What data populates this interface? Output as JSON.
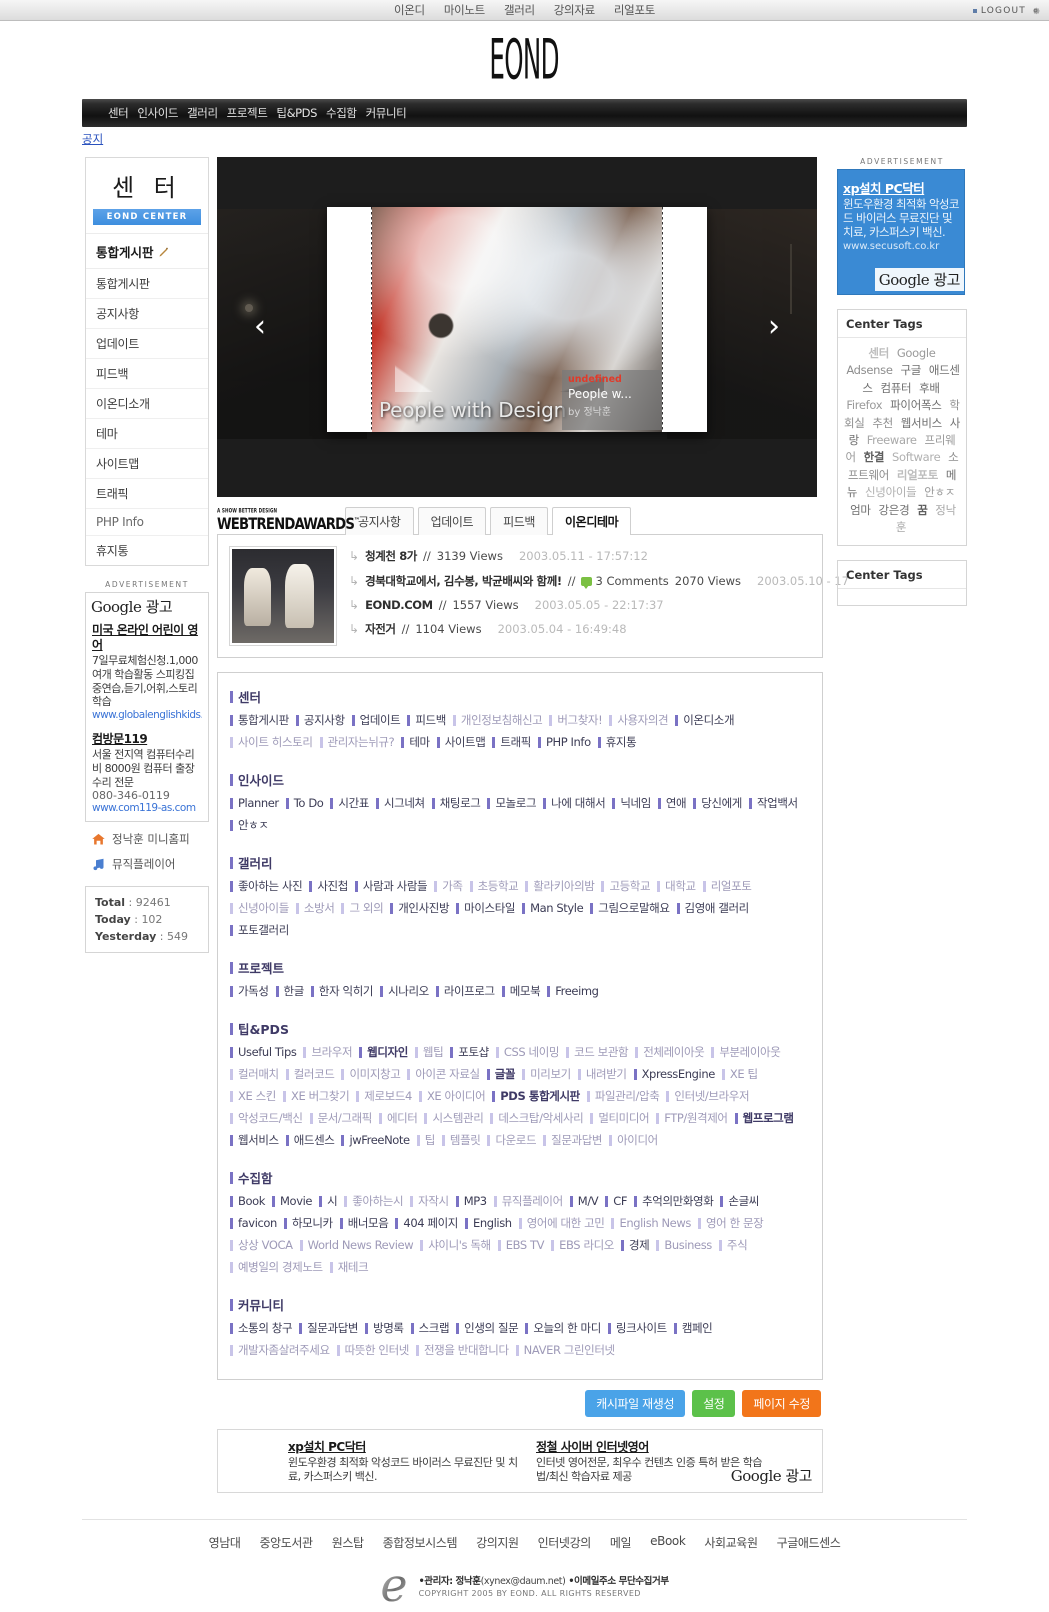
{
  "topbar": {
    "nav": [
      "이온디",
      "마이노트",
      "갤러리",
      "강의자료",
      "리얼포토"
    ],
    "logout_label": "LOGOUT"
  },
  "logo": {
    "text": "EOND"
  },
  "blacknav": {
    "items": [
      "센터",
      "인사이드",
      "갤러리",
      "프로젝트",
      "팁&PDS",
      "수집함",
      "커뮤니티"
    ]
  },
  "subnav": {
    "label": "공지"
  },
  "sidebar": {
    "title": "센 터",
    "badge": "EOND CENTER",
    "head": "통합게시판",
    "items": [
      {
        "label": "통합게시판"
      },
      {
        "label": "공지사항"
      },
      {
        "label": "업데이트"
      },
      {
        "label": "피드백"
      },
      {
        "label": "이온디소개"
      },
      {
        "label": "테마"
      },
      {
        "label": "사이트맵"
      },
      {
        "label": "트래픽"
      },
      {
        "label": "PHP Info"
      },
      {
        "label": "휴지통"
      }
    ],
    "advertisement_label": "ADVERTISEMENT",
    "google_ad_label": "Google 광고",
    "ads": [
      {
        "title": "미국 온라인 어린이 영어",
        "desc": "7일무료체험신청.1,000여개 학습활동 스피킹집중연습,듣기,어휘,스토리학습",
        "url": "www.globalenglishkids.c"
      },
      {
        "title": "컴방문119",
        "desc": "서울 전지역 컴퓨터수리비 8000원 컴퓨터 출장수리 전문",
        "phone": "080-346-0119",
        "url": "www.com119-as.com"
      }
    ],
    "quick_links": [
      {
        "label": "정낙훈 미니홈피",
        "icon": "home-icon"
      },
      {
        "label": "뮤직플레이어",
        "icon": "music-note-icon"
      }
    ],
    "stats": [
      {
        "label": "Total",
        "value": "92461"
      },
      {
        "label": "Today",
        "value": "102"
      },
      {
        "label": "Yesterday",
        "value": "549"
      }
    ]
  },
  "slideshow": {
    "caption": "People with Design",
    "info_tag": "undefined",
    "info_title": "People w...",
    "info_by": "by 정낙훈",
    "prev": "‹",
    "next": "›"
  },
  "awards_badge": {
    "line1": "A  SHOW BETTER DESIGN",
    "line2": "WEBTRENDAWARDS",
    "tm": "™"
  },
  "tabs": [
    {
      "label": "공지사항",
      "active": false
    },
    {
      "label": "업데이트",
      "active": false
    },
    {
      "label": "피드백",
      "active": false
    },
    {
      "label": "이온디테마",
      "active": true
    }
  ],
  "posts": [
    {
      "title": "청계천 8가",
      "sep": "//",
      "views": "3139 Views",
      "date": "2003.05.11 - 17:57:12",
      "comments": ""
    },
    {
      "title": "경북대학교에서, 김수봉, 박균배씨와 함께!",
      "sep": "//",
      "comments": "3 Comments",
      "views": "2070 Views",
      "date": "2003.05.10 - 17"
    },
    {
      "title": "EOND.COM",
      "sep": "//",
      "views": "1557 Views",
      "date": "2003.05.05 - 22:17:37",
      "comments": ""
    },
    {
      "title": "자전거",
      "sep": "//",
      "views": "1104 Views",
      "date": "2003.05.04 - 16:49:48",
      "comments": ""
    }
  ],
  "sitemap": [
    {
      "heading": "센터",
      "links": [
        {
          "label": "통합게시판",
          "state": "on"
        },
        {
          "label": "공지사항",
          "state": "on"
        },
        {
          "label": "업데이트",
          "state": "on"
        },
        {
          "label": "피드백",
          "state": "on"
        },
        {
          "label": "개인정보침해신고",
          "state": "dim"
        },
        {
          "label": "버그찾자!",
          "state": "dim"
        },
        {
          "label": "사용자의견",
          "state": "dim"
        },
        {
          "label": "이온디소개",
          "state": "on"
        },
        {
          "label": "사이트 히스토리",
          "state": "dim"
        },
        {
          "label": "관리자는뉘규?",
          "state": "dim"
        },
        {
          "label": "테마",
          "state": "on"
        },
        {
          "label": "사이트맵",
          "state": "on"
        },
        {
          "label": "트래픽",
          "state": "on"
        },
        {
          "label": "PHP Info",
          "state": "on"
        },
        {
          "label": "휴지통",
          "state": "on"
        }
      ]
    },
    {
      "heading": "인사이드",
      "links": [
        {
          "label": "Planner",
          "state": "on"
        },
        {
          "label": "To Do",
          "state": "on"
        },
        {
          "label": "시간표",
          "state": "on"
        },
        {
          "label": "시그네쳐",
          "state": "on"
        },
        {
          "label": "채팅로그",
          "state": "on"
        },
        {
          "label": "모놀로그",
          "state": "on"
        },
        {
          "label": "나에 대해서",
          "state": "on"
        },
        {
          "label": "닉네임",
          "state": "on"
        },
        {
          "label": "연애",
          "state": "on"
        },
        {
          "label": "당신에게",
          "state": "on"
        },
        {
          "label": "작업백서",
          "state": "on"
        },
        {
          "label": "안ㅎㅈ",
          "state": "on"
        }
      ]
    },
    {
      "heading": "갤러리",
      "links": [
        {
          "label": "좋아하는 사진",
          "state": "on"
        },
        {
          "label": "사진첩",
          "state": "on"
        },
        {
          "label": "사람과 사람들",
          "state": "on"
        },
        {
          "label": "가족",
          "state": "dim"
        },
        {
          "label": "초등학교",
          "state": "dim"
        },
        {
          "label": "활라키아의밤",
          "state": "dim"
        },
        {
          "label": "고등학교",
          "state": "dim"
        },
        {
          "label": "대학교",
          "state": "dim"
        },
        {
          "label": "리얼포토",
          "state": "dim"
        },
        {
          "label": "신녕아이들",
          "state": "dim"
        },
        {
          "label": "소방서",
          "state": "dim"
        },
        {
          "label": "그 외의",
          "state": "dim"
        },
        {
          "label": "개인사진방",
          "state": "on"
        },
        {
          "label": "마이스타일",
          "state": "on"
        },
        {
          "label": "Man Style",
          "state": "on"
        },
        {
          "label": "그림으로말해요",
          "state": "on"
        },
        {
          "label": "김영애 갤러리",
          "state": "on"
        },
        {
          "label": "포토갤러리",
          "state": "on"
        }
      ]
    },
    {
      "heading": "프로젝트",
      "links": [
        {
          "label": "가독성",
          "state": "on"
        },
        {
          "label": "한글",
          "state": "on"
        },
        {
          "label": "한자 익히기",
          "state": "on"
        },
        {
          "label": "시나리오",
          "state": "on"
        },
        {
          "label": "라이프로그",
          "state": "on"
        },
        {
          "label": "메모북",
          "state": "on"
        },
        {
          "label": "Freeimg",
          "state": "on"
        }
      ]
    },
    {
      "heading": "팁&PDS",
      "links": [
        {
          "label": "Useful Tips",
          "state": "on"
        },
        {
          "label": "브라우저",
          "state": "dim"
        },
        {
          "label": "웹디자인",
          "state": "bold"
        },
        {
          "label": "웹팁",
          "state": "dim"
        },
        {
          "label": "포토샵",
          "state": "on"
        },
        {
          "label": "CSS 네이밍",
          "state": "dim"
        },
        {
          "label": "코드 보관함",
          "state": "dim"
        },
        {
          "label": "전체레이아웃",
          "state": "dim"
        },
        {
          "label": "부분레이아웃",
          "state": "dim"
        },
        {
          "label": "컬러매치",
          "state": "dim"
        },
        {
          "label": "컬러코드",
          "state": "dim"
        },
        {
          "label": "이미지창고",
          "state": "dim"
        },
        {
          "label": "아이콘 자료실",
          "state": "dim"
        },
        {
          "label": "글꼴",
          "state": "bold"
        },
        {
          "label": "미리보기",
          "state": "dim"
        },
        {
          "label": "내려받기",
          "state": "dim"
        },
        {
          "label": "XpressEngine",
          "state": "on"
        },
        {
          "label": "XE 팁",
          "state": "dim"
        },
        {
          "label": "XE 스킨",
          "state": "dim"
        },
        {
          "label": "XE 버그찾기",
          "state": "dim"
        },
        {
          "label": "제로보드4",
          "state": "dim"
        },
        {
          "label": "XE 아이디어",
          "state": "dim"
        },
        {
          "label": "PDS 통합게시판",
          "state": "bold"
        },
        {
          "label": "파일관리/압축",
          "state": "dim"
        },
        {
          "label": "인터넷/브라우저",
          "state": "dim"
        },
        {
          "label": "악성코드/백신",
          "state": "dim"
        },
        {
          "label": "문서/그래픽",
          "state": "dim"
        },
        {
          "label": "에디터",
          "state": "dim"
        },
        {
          "label": "시스템관리",
          "state": "dim"
        },
        {
          "label": "데스크탑/악세사리",
          "state": "dim"
        },
        {
          "label": "멀티미디어",
          "state": "dim"
        },
        {
          "label": "FTP/원격제어",
          "state": "dim"
        },
        {
          "label": "웹프로그램",
          "state": "bold"
        },
        {
          "label": "웹서비스",
          "state": "on"
        },
        {
          "label": "애드센스",
          "state": "on"
        },
        {
          "label": "jwFreeNote",
          "state": "on"
        },
        {
          "label": "팁",
          "state": "dim"
        },
        {
          "label": "템플릿",
          "state": "dim"
        },
        {
          "label": "다운로드",
          "state": "dim"
        },
        {
          "label": "질문과답변",
          "state": "dim"
        },
        {
          "label": "아이디어",
          "state": "dim"
        }
      ]
    },
    {
      "heading": "수집함",
      "links": [
        {
          "label": "Book",
          "state": "on"
        },
        {
          "label": "Movie",
          "state": "on"
        },
        {
          "label": "시",
          "state": "on"
        },
        {
          "label": "좋아하는시",
          "state": "dim"
        },
        {
          "label": "자작시",
          "state": "dim"
        },
        {
          "label": "MP3",
          "state": "on"
        },
        {
          "label": "뮤직플레이어",
          "state": "dim"
        },
        {
          "label": "M/V",
          "state": "on"
        },
        {
          "label": "CF",
          "state": "on"
        },
        {
          "label": "추억의만화영화",
          "state": "on"
        },
        {
          "label": "손글씨",
          "state": "on"
        },
        {
          "label": "favicon",
          "state": "on"
        },
        {
          "label": "하모니카",
          "state": "on"
        },
        {
          "label": "배너모음",
          "state": "on"
        },
        {
          "label": "404 페이지",
          "state": "on"
        },
        {
          "label": "English",
          "state": "on"
        },
        {
          "label": "영어에 대한 고민",
          "state": "dim"
        },
        {
          "label": "English News",
          "state": "dim"
        },
        {
          "label": "영어 한 문장",
          "state": "dim"
        },
        {
          "label": "상상 VOCA",
          "state": "dim"
        },
        {
          "label": "World News Review",
          "state": "dim"
        },
        {
          "label": "샤이니's 독해",
          "state": "dim"
        },
        {
          "label": "EBS TV",
          "state": "dim"
        },
        {
          "label": "EBS 라디오",
          "state": "dim"
        },
        {
          "label": "경제",
          "state": "on"
        },
        {
          "label": "Business",
          "state": "dim"
        },
        {
          "label": "주식",
          "state": "dim"
        },
        {
          "label": "예병일의 경제노트",
          "state": "dim"
        },
        {
          "label": "재테크",
          "state": "dim"
        }
      ]
    },
    {
      "heading": "커뮤니티",
      "links": [
        {
          "label": "소통의 창구",
          "state": "on"
        },
        {
          "label": "질문과답변",
          "state": "on"
        },
        {
          "label": "방명록",
          "state": "on"
        },
        {
          "label": "스크랩",
          "state": "on"
        },
        {
          "label": "인생의 질문",
          "state": "on"
        },
        {
          "label": "오늘의 한 마디",
          "state": "on"
        },
        {
          "label": "링크사이트",
          "state": "on"
        },
        {
          "label": "캠페인",
          "state": "on"
        },
        {
          "label": "개발자좀살려주세요",
          "state": "dim"
        },
        {
          "label": "따뜻한 인터넷",
          "state": "dim"
        },
        {
          "label": "전쟁을 반대합니다",
          "state": "dim"
        },
        {
          "label": "NAVER 그린인터넷",
          "state": "dim"
        }
      ]
    }
  ],
  "action_buttons": [
    {
      "label": "캐시파일 재생성",
      "color": "#4aa3e8"
    },
    {
      "label": "설정",
      "color": "#5cc14a"
    },
    {
      "label": "페이지 수정",
      "color": "#f2751a"
    }
  ],
  "bottom_ads": {
    "google_label": "Google 광고",
    "items": [
      {
        "title": "xp설치 PC닥터",
        "desc": "윈도우환경 최적화 악성코드 바이러스 무료진단 및 치료, 카스퍼스키 백신."
      },
      {
        "title": "정철 사이버 인터넷영어",
        "desc": "인터넷 영어전문, 최우수 컨텐츠 인증 특허 받은 학습법/최신 학습자료 제공"
      }
    ]
  },
  "right_sidebar": {
    "advertisement_label": "ADVERTISEMENT",
    "ad": {
      "title": "xp설치 PC닥터",
      "desc": "윈도우환경 최적화 악성코드 바이러스 무료진단 및 치료, 카스퍼스키 백신.",
      "url": "www.secusoft.co.kr",
      "google_label": "Google 광고"
    },
    "tagbox1_title": "Center Tags",
    "tagbox2_title": "Center Tags",
    "tags": [
      {
        "label": "센터",
        "w": "b",
        "c": "#bdbdbd"
      },
      {
        "label": "Google",
        "w": "n",
        "c": "#9a9a9a"
      },
      {
        "label": "Adsense",
        "w": "n",
        "c": "#8e8e8e"
      },
      {
        "label": "구글",
        "w": "n",
        "c": "#6f6f6f"
      },
      {
        "label": "애드센스",
        "w": "n",
        "c": "#6f6f6f"
      },
      {
        "label": "컴퓨터",
        "w": "n",
        "c": "#6f6f6f"
      },
      {
        "label": "후배",
        "w": "n",
        "c": "#6f6f6f"
      },
      {
        "label": "Firefox",
        "w": "n",
        "c": "#9a9a9a"
      },
      {
        "label": "파이어폭스",
        "w": "n",
        "c": "#6f6f6f"
      },
      {
        "label": "학회실",
        "w": "n",
        "c": "#8e8e8e"
      },
      {
        "label": "추천",
        "w": "n",
        "c": "#8e8e8e"
      },
      {
        "label": "웹서비스",
        "w": "n",
        "c": "#6f6f6f"
      },
      {
        "label": "사랑",
        "w": "n",
        "c": "#6f6f6f"
      },
      {
        "label": "Freeware",
        "w": "n",
        "c": "#a8a8a8"
      },
      {
        "label": "프리웨어",
        "w": "n",
        "c": "#9a9a9a"
      },
      {
        "label": "한결",
        "w": "b",
        "c": "#5f5f5f"
      },
      {
        "label": "Software",
        "w": "n",
        "c": "#b0b0b0"
      },
      {
        "label": "소프트웨어",
        "w": "n",
        "c": "#8e8e8e"
      },
      {
        "label": "리얼포토",
        "w": "b",
        "c": "#bdbdbd"
      },
      {
        "label": "메뉴",
        "w": "n",
        "c": "#6f6f6f"
      },
      {
        "label": "신녕아이들",
        "w": "n",
        "c": "#b0b0b0"
      },
      {
        "label": "안ㅎㅈ",
        "w": "n",
        "c": "#9a9a9a"
      },
      {
        "label": "엄마",
        "w": "n",
        "c": "#6f6f6f"
      },
      {
        "label": "강은경",
        "w": "n",
        "c": "#6f6f6f"
      },
      {
        "label": "꿈",
        "w": "b",
        "c": "#5f5f5f"
      },
      {
        "label": "정낙훈",
        "w": "n",
        "c": "#a8a8a8"
      }
    ]
  },
  "footer": {
    "nav": [
      "영남대",
      "중앙도서관",
      "원스탑",
      "종합정보시스템",
      "강의지원",
      "인터넷강의",
      "메일",
      "eBook",
      "사회교육원",
      "구글애드센스"
    ],
    "admin": "•관리자: 정낙훈",
    "admin_mail": "(xynex@daum.net)",
    "reject": "•이메일주소 무단수집거부",
    "copyright": "COPYRIGHT 2005 BY EOND. ALL RIGHTS RESERVED"
  }
}
